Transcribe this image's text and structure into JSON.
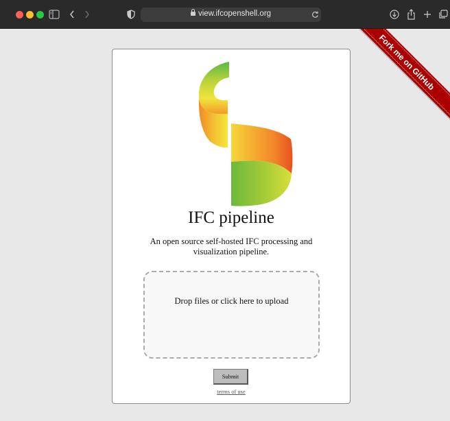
{
  "browser": {
    "url": "view.ifcopenshell.org",
    "icons": [
      "sidebar-icon",
      "back-icon",
      "forward-icon",
      "shield-icon",
      "lock-icon",
      "reload-icon",
      "download-icon",
      "share-icon",
      "new-tab-icon",
      "tabs-overview-icon"
    ]
  },
  "ribbon": {
    "label": "Fork me on GitHub",
    "color": "#aa0000"
  },
  "page": {
    "title": "IFC pipeline",
    "description": "An open source self-hosted IFC processing and visualization pipeline.",
    "dropzone_label": "Drop files or click here to upload",
    "submit_label": "Submit",
    "terms_label": "terms of use"
  }
}
